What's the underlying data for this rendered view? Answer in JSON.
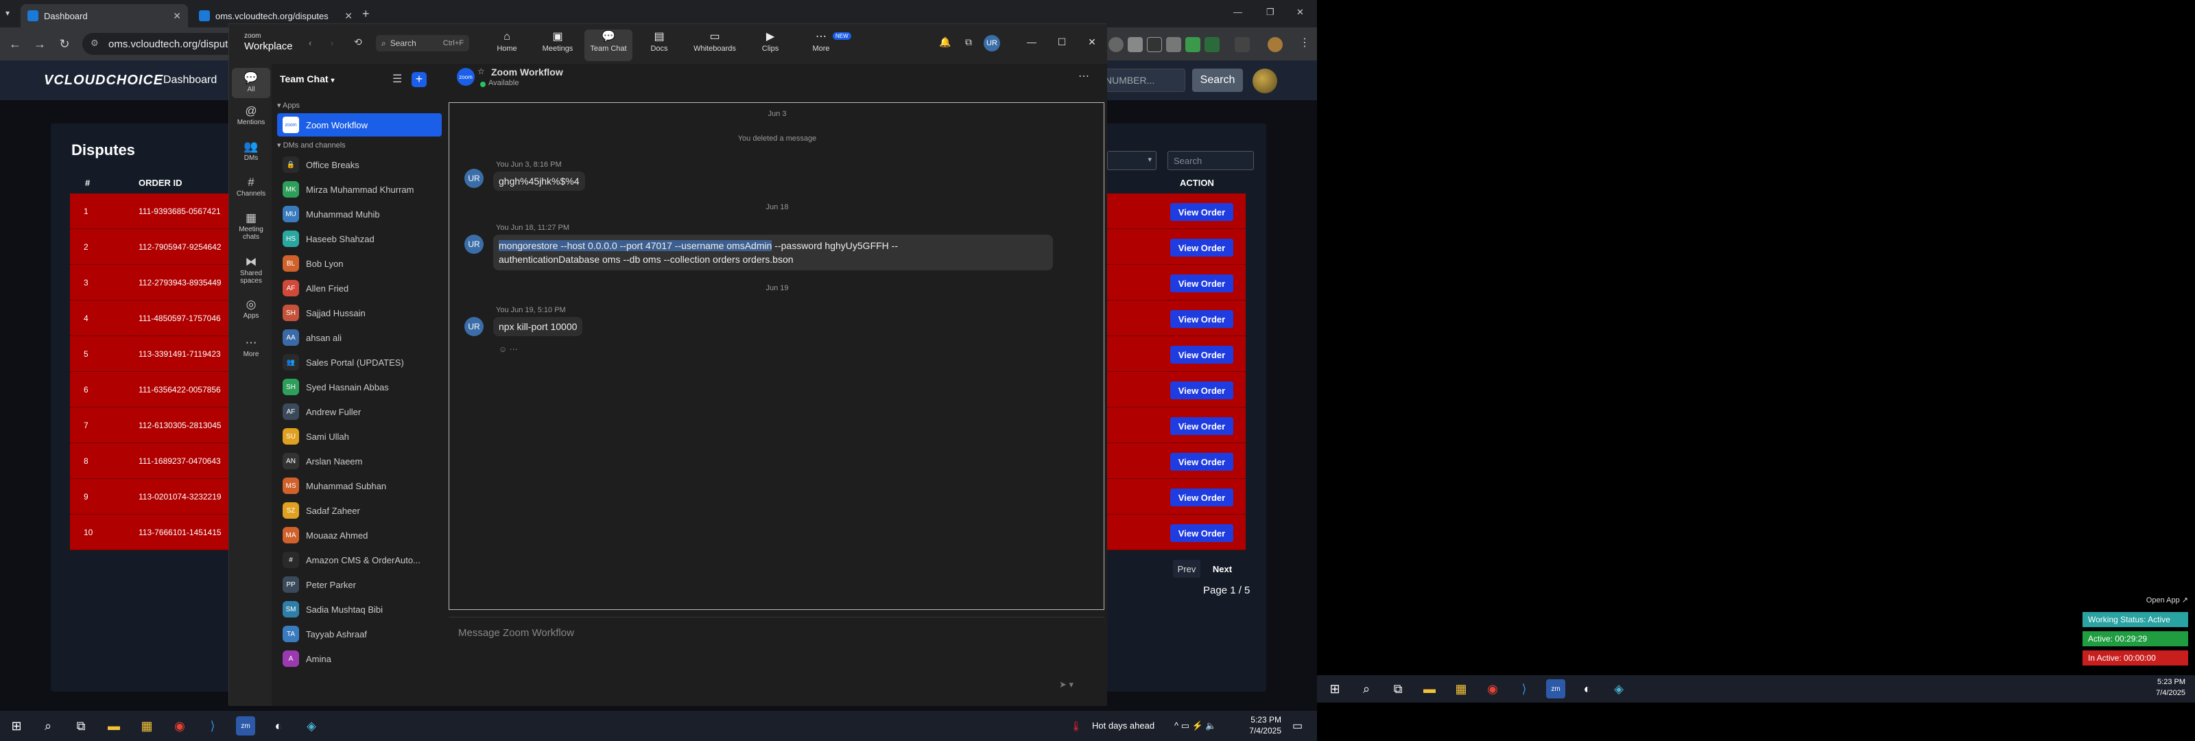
{
  "browser": {
    "tabs": [
      {
        "title": "Dashboard",
        "active": true
      },
      {
        "title": "oms.vcloudtech.org/disputes",
        "active": false
      }
    ],
    "url": "oms.vcloudtech.org/disputes"
  },
  "site": {
    "logo": "VCLOUDCHOICE",
    "nav_dashboard": "Dashboard",
    "search_placeholder": "NUMBER...",
    "search_button": "Search",
    "page_title": "Disputes",
    "filter_search_placeholder": "Search",
    "columns": {
      "num": "#",
      "order_id": "ORDER ID",
      "action": "ACTION"
    },
    "rows": [
      {
        "num": "1",
        "order_id": "111-9393685-0567421",
        "action": "View Order"
      },
      {
        "num": "2",
        "order_id": "112-7905947-9254642",
        "action": "View Order"
      },
      {
        "num": "3",
        "order_id": "112-2793943-8935449",
        "action": "View Order"
      },
      {
        "num": "4",
        "order_id": "111-4850597-1757046",
        "action": "View Order"
      },
      {
        "num": "5",
        "order_id": "113-3391491-7119423",
        "action": "View Order"
      },
      {
        "num": "6",
        "order_id": "111-6356422-0057856",
        "action": "View Order"
      },
      {
        "num": "7",
        "order_id": "112-6130305-2813045",
        "action": "View Order"
      },
      {
        "num": "8",
        "order_id": "111-1689237-0470643",
        "action": "View Order"
      },
      {
        "num": "9",
        "order_id": "113-0201074-3232219",
        "action": "View Order"
      },
      {
        "num": "10",
        "order_id": "113-7666101-1451415",
        "action": "View Order"
      }
    ],
    "prev": "Prev",
    "next": "Next",
    "page_info": "Page 1 / 5"
  },
  "zoom": {
    "logo_small": "zoom",
    "logo_big": "Workplace",
    "search": "Search",
    "search_shortcut": "Ctrl+F",
    "tabs": [
      "Home",
      "Meetings",
      "Team Chat",
      "Docs",
      "Whiteboards",
      "Clips",
      "More"
    ],
    "new_badge": "NEW",
    "rail": [
      "All",
      "Mentions",
      "DMs",
      "Channels",
      "Meeting chats",
      "Shared spaces",
      "Apps",
      "More"
    ],
    "list_title": "Team Chat",
    "sections": {
      "apps": "Apps",
      "dms": "DMs and channels"
    },
    "selected_app": "Zoom Workflow",
    "contacts": [
      {
        "name": "Office Breaks",
        "initials": "🔒",
        "color": "#2a2a2a"
      },
      {
        "name": "Mirza Muhammad Khurram",
        "initials": "MK",
        "color": "#2e9e5b"
      },
      {
        "name": "Muhammad Muhib",
        "initials": "MU",
        "color": "#3a7bbf"
      },
      {
        "name": "Haseeb Shahzad",
        "initials": "HS",
        "color": "#2aa8a0"
      },
      {
        "name": "Bob Lyon",
        "initials": "BL",
        "color": "#d0612b"
      },
      {
        "name": "Allen Fried",
        "initials": "AF",
        "color": "#d04a3a"
      },
      {
        "name": "Sajjad Hussain",
        "initials": "SH",
        "color": "#c5533b"
      },
      {
        "name": "ahsan ali",
        "initials": "AA",
        "color": "#3a6aa8"
      },
      {
        "name": "Sales Portal (UPDATES)",
        "initials": "👥",
        "color": "#2a2a2a"
      },
      {
        "name": "Syed Hasnain Abbas",
        "initials": "SH",
        "color": "#2e9e5b"
      },
      {
        "name": "Andrew Fuller",
        "initials": "AF",
        "color": "#3a4a5a"
      },
      {
        "name": "Sami Ullah",
        "initials": "SU",
        "color": "#e0a020"
      },
      {
        "name": "Arslan Naeem",
        "initials": "AN",
        "color": "#333333"
      },
      {
        "name": "Muhammad Subhan",
        "initials": "MS",
        "color": "#d0612b"
      },
      {
        "name": "Sadaf Zaheer",
        "initials": "SZ",
        "color": "#e0a020"
      },
      {
        "name": "Mouaaz Ahmed",
        "initials": "MA",
        "color": "#d0612b"
      },
      {
        "name": "Amazon CMS & OrderAuto...",
        "initials": "#",
        "color": "#2a2a2a"
      },
      {
        "name": "Peter Parker",
        "initials": "PP",
        "color": "#3a4a5a"
      },
      {
        "name": "Sadia Mushtaq Bibi",
        "initials": "SM",
        "color": "#2e7ea8"
      },
      {
        "name": "Tayyab Ashraaf",
        "initials": "TA",
        "color": "#3a7bbf"
      },
      {
        "name": "Amina",
        "initials": "A",
        "color": "#9b3ab0"
      }
    ],
    "chat": {
      "title": "Zoom Workflow",
      "status": "Available",
      "date1": "Jun 3",
      "deleted": "You deleted a message",
      "m1_meta": "You Jun 3, 8:16 PM",
      "m1_text": "ghgh%45jhk%$%4",
      "date2": "Jun 18",
      "m2_meta": "You Jun 18, 11:27 PM",
      "m2_line1_sel": "mongorestore   --host 0.0.0.0   --port 47017   --username omsAdmin",
      "m2_line1_rest": "   --password hghyUy5GFFH   --",
      "m2_line2": "authenticationDatabase oms   --db oms   --collection orders   orders.bson",
      "date3": "Jun 19",
      "m3_meta": "You Jun 19, 5:10 PM",
      "m3_text": "npx kill-port 10000",
      "avatar": "UR",
      "compose_placeholder": "Message Zoom Workflow"
    }
  },
  "taskbar_left": {
    "weather": "Hot days ahead",
    "time": "5:23 PM",
    "date": "7/4/2025"
  },
  "taskbar_right": {
    "time": "5:23 PM",
    "date": "7/4/2025"
  },
  "tracker": {
    "open_app": "Open App ↗",
    "working_status": "Working Status: Active",
    "active": "Active: 00:29:29",
    "inactive": "In Active: 00:00:00"
  }
}
